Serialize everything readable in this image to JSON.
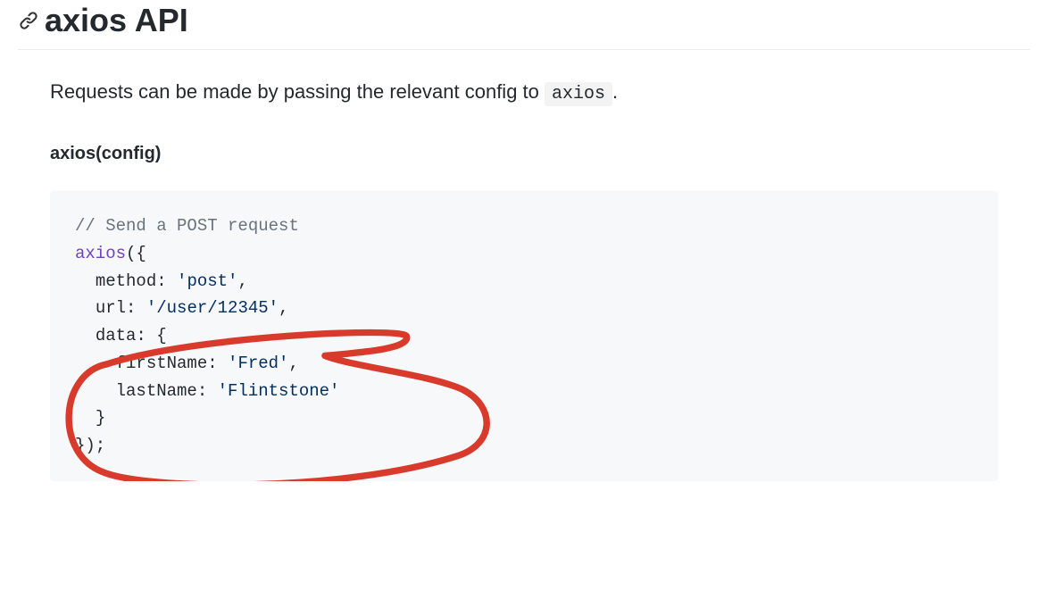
{
  "heading": "axios API",
  "intro_prefix": "Requests can be made by passing the relevant config to ",
  "intro_code": "axios",
  "intro_suffix": ".",
  "signature": "axios(config)",
  "code": {
    "comment": "// Send a POST request",
    "fn": "axios",
    "open_paren": "({",
    "method_key": "method",
    "method_val": "'post'",
    "url_key": "url",
    "url_val": "'/user/12345'",
    "data_key": "data",
    "data_open": "{",
    "firstName_key": "firstName",
    "firstName_val": "'Fred'",
    "lastName_key": "lastName",
    "lastName_val": "'Flintstone'",
    "data_close": "}",
    "close": "});",
    "colon": ":",
    "comma": ","
  }
}
